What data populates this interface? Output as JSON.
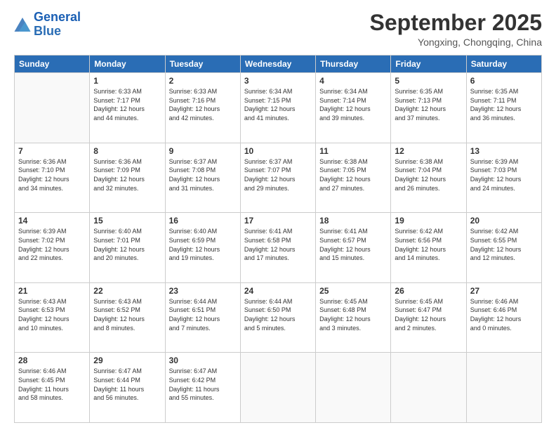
{
  "logo": {
    "line1": "General",
    "line2": "Blue"
  },
  "title": "September 2025",
  "subtitle": "Yongxing, Chongqing, China",
  "days_of_week": [
    "Sunday",
    "Monday",
    "Tuesday",
    "Wednesday",
    "Thursday",
    "Friday",
    "Saturday"
  ],
  "weeks": [
    [
      {
        "day": "",
        "info": ""
      },
      {
        "day": "1",
        "info": "Sunrise: 6:33 AM\nSunset: 7:17 PM\nDaylight: 12 hours\nand 44 minutes."
      },
      {
        "day": "2",
        "info": "Sunrise: 6:33 AM\nSunset: 7:16 PM\nDaylight: 12 hours\nand 42 minutes."
      },
      {
        "day": "3",
        "info": "Sunrise: 6:34 AM\nSunset: 7:15 PM\nDaylight: 12 hours\nand 41 minutes."
      },
      {
        "day": "4",
        "info": "Sunrise: 6:34 AM\nSunset: 7:14 PM\nDaylight: 12 hours\nand 39 minutes."
      },
      {
        "day": "5",
        "info": "Sunrise: 6:35 AM\nSunset: 7:13 PM\nDaylight: 12 hours\nand 37 minutes."
      },
      {
        "day": "6",
        "info": "Sunrise: 6:35 AM\nSunset: 7:11 PM\nDaylight: 12 hours\nand 36 minutes."
      }
    ],
    [
      {
        "day": "7",
        "info": "Sunrise: 6:36 AM\nSunset: 7:10 PM\nDaylight: 12 hours\nand 34 minutes."
      },
      {
        "day": "8",
        "info": "Sunrise: 6:36 AM\nSunset: 7:09 PM\nDaylight: 12 hours\nand 32 minutes."
      },
      {
        "day": "9",
        "info": "Sunrise: 6:37 AM\nSunset: 7:08 PM\nDaylight: 12 hours\nand 31 minutes."
      },
      {
        "day": "10",
        "info": "Sunrise: 6:37 AM\nSunset: 7:07 PM\nDaylight: 12 hours\nand 29 minutes."
      },
      {
        "day": "11",
        "info": "Sunrise: 6:38 AM\nSunset: 7:05 PM\nDaylight: 12 hours\nand 27 minutes."
      },
      {
        "day": "12",
        "info": "Sunrise: 6:38 AM\nSunset: 7:04 PM\nDaylight: 12 hours\nand 26 minutes."
      },
      {
        "day": "13",
        "info": "Sunrise: 6:39 AM\nSunset: 7:03 PM\nDaylight: 12 hours\nand 24 minutes."
      }
    ],
    [
      {
        "day": "14",
        "info": "Sunrise: 6:39 AM\nSunset: 7:02 PM\nDaylight: 12 hours\nand 22 minutes."
      },
      {
        "day": "15",
        "info": "Sunrise: 6:40 AM\nSunset: 7:01 PM\nDaylight: 12 hours\nand 20 minutes."
      },
      {
        "day": "16",
        "info": "Sunrise: 6:40 AM\nSunset: 6:59 PM\nDaylight: 12 hours\nand 19 minutes."
      },
      {
        "day": "17",
        "info": "Sunrise: 6:41 AM\nSunset: 6:58 PM\nDaylight: 12 hours\nand 17 minutes."
      },
      {
        "day": "18",
        "info": "Sunrise: 6:41 AM\nSunset: 6:57 PM\nDaylight: 12 hours\nand 15 minutes."
      },
      {
        "day": "19",
        "info": "Sunrise: 6:42 AM\nSunset: 6:56 PM\nDaylight: 12 hours\nand 14 minutes."
      },
      {
        "day": "20",
        "info": "Sunrise: 6:42 AM\nSunset: 6:55 PM\nDaylight: 12 hours\nand 12 minutes."
      }
    ],
    [
      {
        "day": "21",
        "info": "Sunrise: 6:43 AM\nSunset: 6:53 PM\nDaylight: 12 hours\nand 10 minutes."
      },
      {
        "day": "22",
        "info": "Sunrise: 6:43 AM\nSunset: 6:52 PM\nDaylight: 12 hours\nand 8 minutes."
      },
      {
        "day": "23",
        "info": "Sunrise: 6:44 AM\nSunset: 6:51 PM\nDaylight: 12 hours\nand 7 minutes."
      },
      {
        "day": "24",
        "info": "Sunrise: 6:44 AM\nSunset: 6:50 PM\nDaylight: 12 hours\nand 5 minutes."
      },
      {
        "day": "25",
        "info": "Sunrise: 6:45 AM\nSunset: 6:48 PM\nDaylight: 12 hours\nand 3 minutes."
      },
      {
        "day": "26",
        "info": "Sunrise: 6:45 AM\nSunset: 6:47 PM\nDaylight: 12 hours\nand 2 minutes."
      },
      {
        "day": "27",
        "info": "Sunrise: 6:46 AM\nSunset: 6:46 PM\nDaylight: 12 hours\nand 0 minutes."
      }
    ],
    [
      {
        "day": "28",
        "info": "Sunrise: 6:46 AM\nSunset: 6:45 PM\nDaylight: 11 hours\nand 58 minutes."
      },
      {
        "day": "29",
        "info": "Sunrise: 6:47 AM\nSunset: 6:44 PM\nDaylight: 11 hours\nand 56 minutes."
      },
      {
        "day": "30",
        "info": "Sunrise: 6:47 AM\nSunset: 6:42 PM\nDaylight: 11 hours\nand 55 minutes."
      },
      {
        "day": "",
        "info": ""
      },
      {
        "day": "",
        "info": ""
      },
      {
        "day": "",
        "info": ""
      },
      {
        "day": "",
        "info": ""
      }
    ]
  ]
}
